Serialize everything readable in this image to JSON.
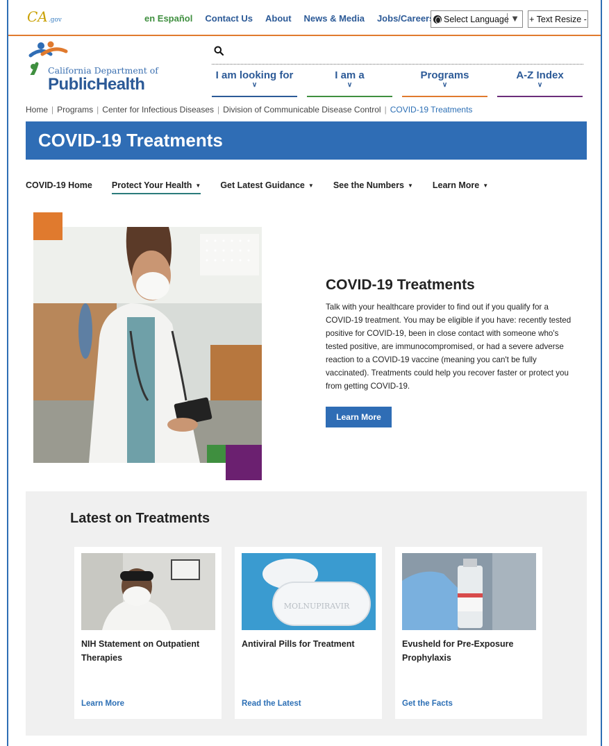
{
  "utility": {
    "espanol": "en Español",
    "links": [
      "Contact Us",
      "About",
      "News & Media",
      "Jobs/Careers"
    ],
    "language_select": "Select Language",
    "text_resize": "+ Text Resize -"
  },
  "header": {
    "logo_dept": "California Department of",
    "logo_name": "PublicHealth",
    "nav": [
      "I am looking for",
      "I am a",
      "Programs",
      "A-Z Index"
    ]
  },
  "breadcrumb": [
    "Home",
    "Programs",
    "Center for Infectious Diseases",
    "Division of Communicable Disease Control",
    "COVID-19 Treatments"
  ],
  "page": {
    "title": "COVID-19 Treatments"
  },
  "subnav": [
    "COVID-19 Home",
    "Protect Your Health",
    "Get Latest Guidance",
    "See the Numbers",
    "Learn More"
  ],
  "hero": {
    "heading": "COVID-19 Treatments",
    "body": "Talk with your healthcare provider to find out if you qualify for a COVID-19 treatment. You may be eligible if you have: recently tested positive for COVID-19, been in close contact with someone who's tested positive, are immunocompromised, or had a severe adverse reaction to a COVID-19 vaccine (meaning you can't be fully vaccinated). Treatments could help you recover faster or protect you from getting COVID-19.",
    "button": "Learn More"
  },
  "latest": {
    "heading": "Latest on Treatments",
    "cards": [
      {
        "title": "NIH Statement on Outpatient Therapies",
        "link": "Learn More"
      },
      {
        "title": "Antiviral Pills for Treatment",
        "link": "Read the Latest",
        "pill_label": "MOLNUPIRAVIR"
      },
      {
        "title": "Evusheld for Pre-Exposure Prophylaxis",
        "link": "Get the Facts"
      }
    ]
  }
}
